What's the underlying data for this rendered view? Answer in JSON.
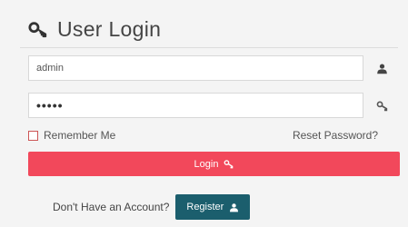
{
  "title": "User Login",
  "username": {
    "value": "admin",
    "icon": "user-icon"
  },
  "password": {
    "value": "•••••",
    "icon": "key-icon"
  },
  "remember_label": "Remember Me",
  "reset_label": "Reset Password?",
  "login_label": "Login",
  "signup_prompt": "Don't Have an Account?",
  "register_label": "Register",
  "colors": {
    "login_button": "#f2485b",
    "register_button": "#1b5e6d",
    "background": "#f4f4f4"
  }
}
